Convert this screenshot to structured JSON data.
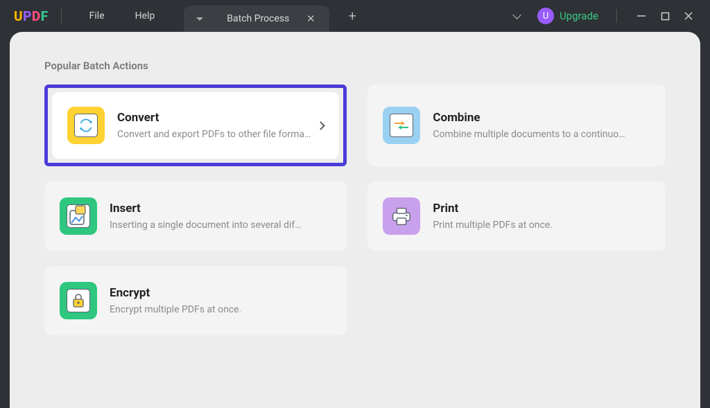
{
  "app": {
    "name": "UPDF"
  },
  "menus": {
    "file": "File",
    "help": "Help"
  },
  "tab": {
    "label": "Batch Process"
  },
  "upgrade": {
    "initial": "U",
    "label": "Upgrade"
  },
  "section": {
    "title": "Popular Batch Actions"
  },
  "cards": {
    "convert": {
      "title": "Convert",
      "desc": "Convert and export PDFs to other file forma…"
    },
    "combine": {
      "title": "Combine",
      "desc": "Combine multiple documents to a continuo…"
    },
    "insert": {
      "title": "Insert",
      "desc": "Inserting a single document into several dif…"
    },
    "print": {
      "title": "Print",
      "desc": "Print multiple PDFs at once."
    },
    "encrypt": {
      "title": "Encrypt",
      "desc": "Encrypt multiple PDFs at once."
    }
  }
}
